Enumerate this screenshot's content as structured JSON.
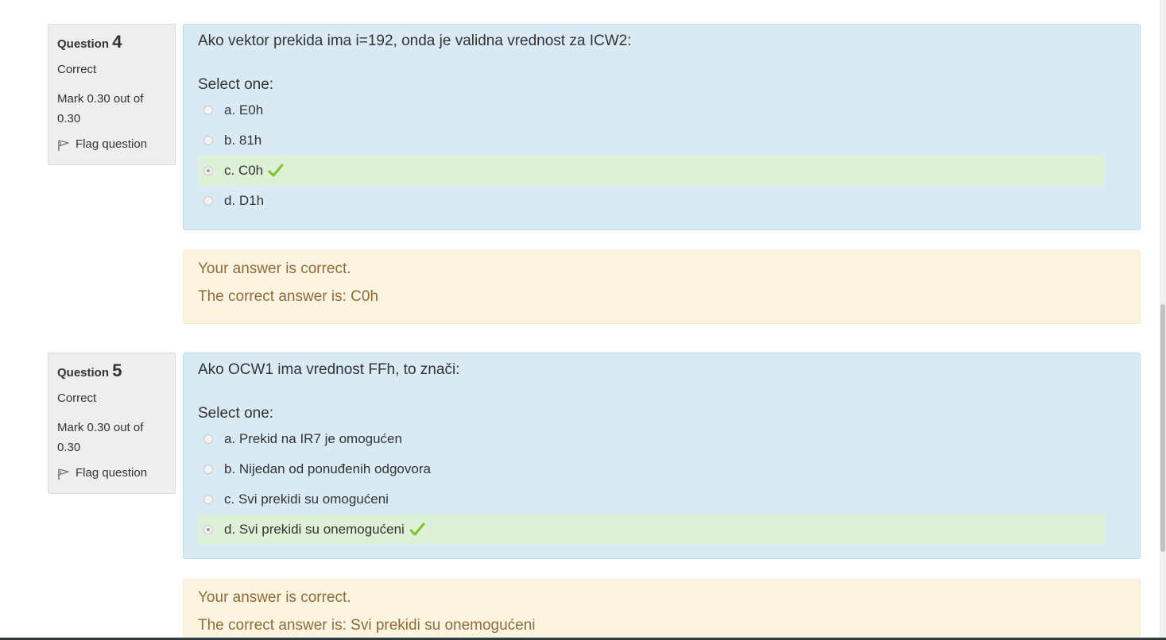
{
  "questions": [
    {
      "label": "Question",
      "number": "4",
      "state": "Correct",
      "grade": "Mark 0.30 out of 0.30",
      "flag_label": "Flag question",
      "text": "Ako vektor prekida ima i=192, onda je validna vrednost za ICW2:",
      "prompt": "Select one:",
      "options": [
        {
          "label": "a. E0h",
          "selected": false,
          "correct": false
        },
        {
          "label": "b. 81h",
          "selected": false,
          "correct": false
        },
        {
          "label": "c. C0h",
          "selected": true,
          "correct": true
        },
        {
          "label": "d. D1h",
          "selected": false,
          "correct": false
        }
      ],
      "feedback": "Your answer is correct.",
      "right_answer": "The correct answer is: C0h"
    },
    {
      "label": "Question",
      "number": "5",
      "state": "Correct",
      "grade": "Mark 0.30 out of 0.30",
      "flag_label": "Flag question",
      "text": "Ako OCW1 ima vrednost FFh, to znači:",
      "prompt": "Select one:",
      "options": [
        {
          "label": "a. Prekid na IR7 je omogućen",
          "selected": false,
          "correct": false
        },
        {
          "label": "b. Nijedan od ponuđenih odgovora",
          "selected": false,
          "correct": false
        },
        {
          "label": "c. Svi prekidi su omogućeni",
          "selected": false,
          "correct": false
        },
        {
          "label": "d. Svi prekidi su onemogućeni",
          "selected": true,
          "correct": true
        }
      ],
      "feedback": "Your answer is correct.",
      "right_answer": "The correct answer is: Svi prekidi su onemogućeni"
    }
  ],
  "icons": {
    "flag": "flag-icon",
    "correct": "check-icon"
  },
  "colors": {
    "formulation_bg": "#d9eaf5",
    "correct_option_bg": "#dff0d8",
    "outcome_bg": "#fcf4e0",
    "outcome_text": "#8a6d3b",
    "tick": "#7cc428"
  }
}
